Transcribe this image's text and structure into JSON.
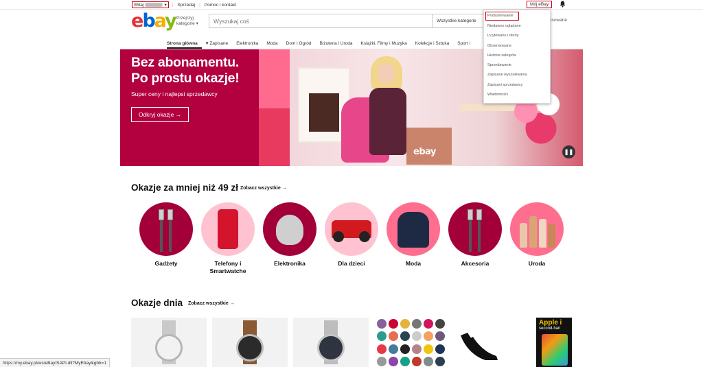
{
  "topbar": {
    "greeting": "Witaj",
    "sell": "Sprzedaj",
    "help": "Pomoc i kontakt",
    "my_ebay": "Mój eBay"
  },
  "header": {
    "logo": {
      "e": "e",
      "b": "b",
      "a": "a",
      "y": "y"
    },
    "shop_by_category": "Przejrzyj kategorie",
    "search_placeholder": "Wyszukaj coś",
    "category_select": "Wszystkie kategorie",
    "advanced": "nsowane"
  },
  "nav": {
    "items": [
      "Strona główna",
      "Zapisane",
      "Elektronika",
      "Moda",
      "Dom i Ogród",
      "Biżuteria i Uroda",
      "Książki, Filmy i Muzyka",
      "Kolekcje i Sztuka",
      "Sport i"
    ]
  },
  "hero": {
    "title_line1": "Bez abonamentu.",
    "title_line2": "Po prostu okazje!",
    "subtitle": "Super ceny i najlepsi sprzedawcy",
    "cta": "Odkryj okazje →",
    "box_label": "ebay",
    "pause_icon": "❚❚"
  },
  "dropdown": {
    "items": [
      "Podsumowanie",
      "Niedawno oglądane",
      "Licytowane i oferty",
      "Obserwowane",
      "Historia zakupów",
      "Sprzedawanie",
      "Zapisane wyszukiwania",
      "Zapisani sprzedawcy",
      "Wiadomości"
    ]
  },
  "deals": {
    "title": "Okazje za mniej niż 49 zł",
    "see_all": "Zobacz wszystkie →",
    "categories": [
      {
        "label": "Gadżety",
        "bg": "#a3003a",
        "icon": "cable-icon"
      },
      {
        "label": "Telefony i Smartwatche",
        "bg": "#ffc2d1",
        "icon": "phone-icon"
      },
      {
        "label": "Elektronika",
        "bg": "#a3003a",
        "icon": "speaker-icon"
      },
      {
        "label": "Dla dzieci",
        "bg": "#ffc2d1",
        "icon": "quad-toy-icon"
      },
      {
        "label": "Moda",
        "bg": "#ff6e8e",
        "icon": "hoodie-icon"
      },
      {
        "label": "Akcesoria",
        "bg": "#a3003a",
        "icon": "cable-icon"
      },
      {
        "label": "Uroda",
        "bg": "#ff6e8e",
        "icon": "cosmetics-icon"
      }
    ]
  },
  "daily": {
    "title": "Okazje dnia",
    "see_all": "Zobacz wszystkie →",
    "apple_badge_line1": "Apple i",
    "apple_badge_line2": "second-han"
  },
  "statusbar": {
    "url": "https://my.ebay.pl/ws/eBayISAPI.dll?MyEbay&gbh=1"
  },
  "colors": {
    "brand_red": "#e53238",
    "brand_blue": "#0064d2",
    "brand_yellow": "#f5af02",
    "brand_green": "#86b817",
    "hero_bg": "#b3003f",
    "highlight": "#d0021b"
  }
}
